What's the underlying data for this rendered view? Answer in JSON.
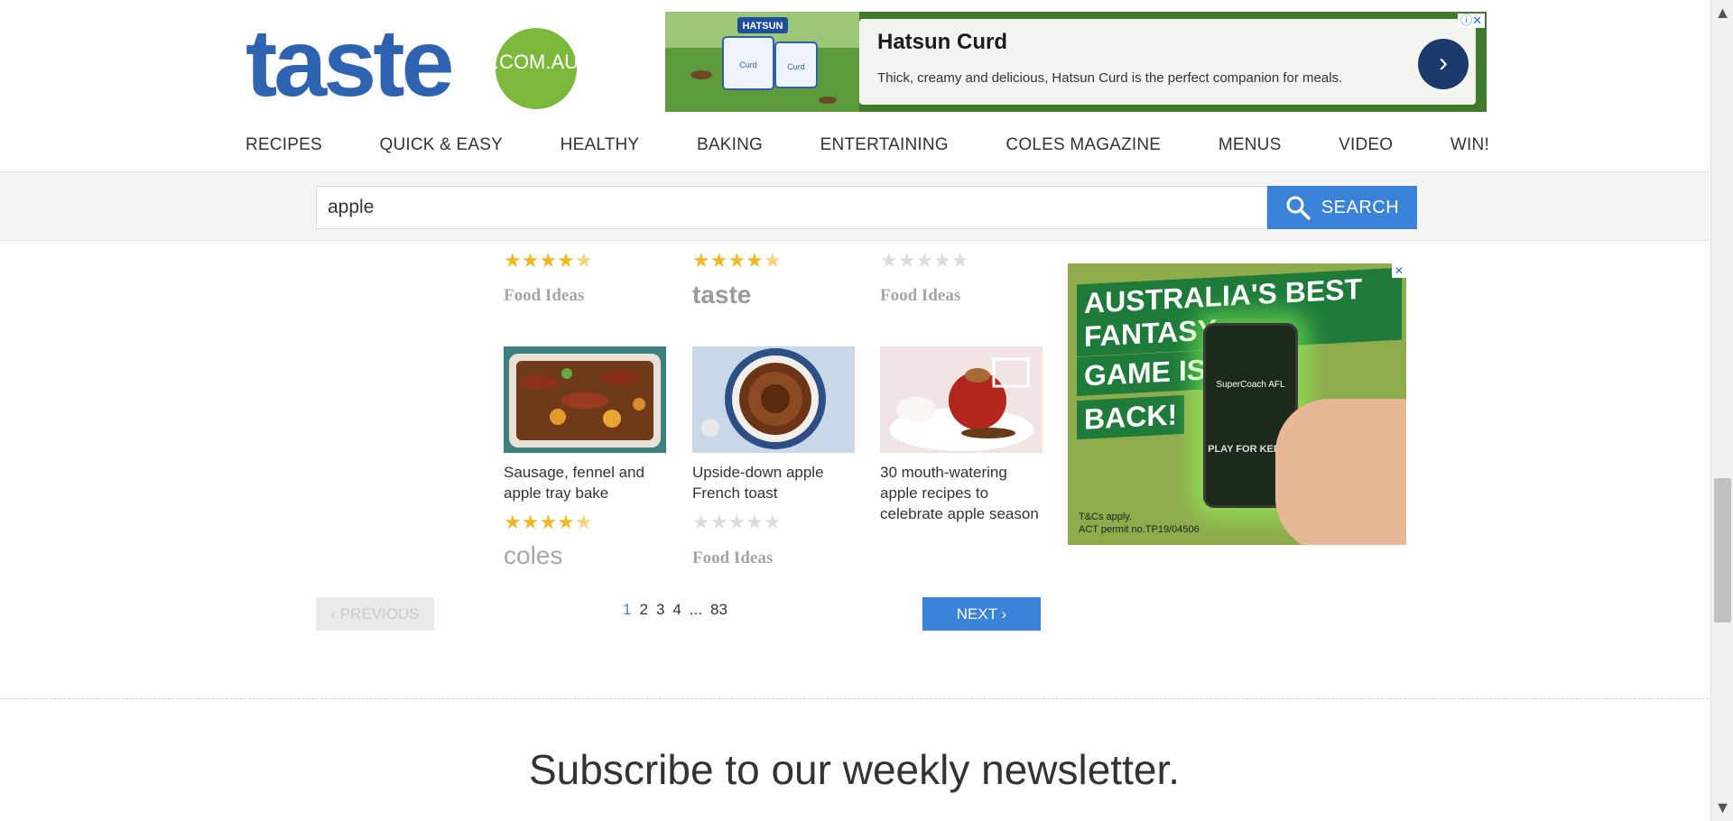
{
  "header": {
    "logo_text": "taste",
    "logo_badge": ".COM.AU",
    "ad": {
      "title": "Hatsun Curd",
      "text": "Thick, creamy and delicious, Hatsun Curd is the perfect companion for meals.",
      "brand_label": "HATSUN",
      "tub_label": "Curd",
      "cta": "›",
      "info": "ⓘ✕"
    }
  },
  "nav": {
    "items": [
      "RECIPES",
      "QUICK & EASY",
      "HEALTHY",
      "BAKING",
      "ENTERTAINING",
      "COLES MAGAZINE",
      "MENUS",
      "VIDEO",
      "WIN!"
    ]
  },
  "search": {
    "value": "apple",
    "button_label": "SEARCH"
  },
  "top_row": [
    {
      "rating": 4.5,
      "brand": "Food Ideas"
    },
    {
      "rating": 4.5,
      "brand": "taste"
    },
    {
      "rating": 0,
      "brand": "Food Ideas"
    }
  ],
  "cards": [
    {
      "title": "Sausage, fennel and apple tray bake",
      "rating": 4.5,
      "brand": "coles"
    },
    {
      "title": "Upside-down apple French toast",
      "rating": 0,
      "brand": "Food Ideas"
    },
    {
      "title": "30 mouth-watering apple recipes to celebrate apple season"
    }
  ],
  "right_ad": {
    "headline": [
      "AUSTRALIA'S BEST FANTASY",
      "GAME IS",
      "BACK!"
    ],
    "phone_text": "SuperCoach AFL",
    "play": "PLAY FOR KEEPS",
    "fine_1": "T&Cs apply.",
    "fine_2": "ACT permit no.TP19/04506",
    "close": "✕"
  },
  "pagination": {
    "prev_label": "‹ PREVIOUS",
    "next_label": "NEXT ›",
    "pages": [
      "1",
      "2",
      "3",
      "4",
      "...",
      "83"
    ],
    "current": "1"
  },
  "newsletter": {
    "title": "Subscribe to our weekly newsletter."
  },
  "colors": {
    "brand_blue": "#2d63b0",
    "brand_green": "#7cb83b",
    "button_blue": "#3b83d9",
    "star": "#f2b824"
  }
}
